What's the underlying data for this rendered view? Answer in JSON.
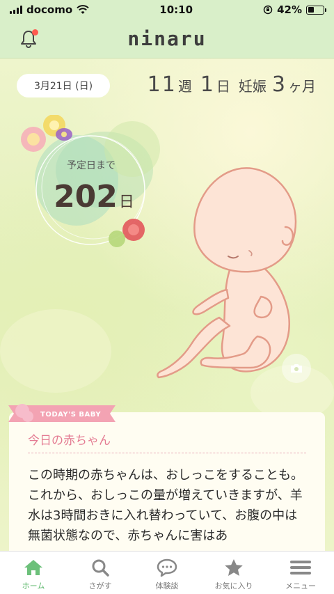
{
  "status_bar": {
    "carrier": "docomo",
    "time": "10:10",
    "battery_percent": "42%",
    "battery_level": 0.42
  },
  "header": {
    "logo": "ninaru",
    "notification_badge": true
  },
  "pregnancy": {
    "date": "3月21日 (日)",
    "weeks": "11",
    "weeks_unit": "週",
    "days": "1",
    "days_unit": "日",
    "month_label": "妊娠",
    "months": "3",
    "months_unit": "ヶ月",
    "due_label": "予定日まで",
    "due_days": "202",
    "due_days_unit": "日"
  },
  "today_card": {
    "ribbon": "TODAY'S BABY",
    "title": "今日の赤ちゃん",
    "body": "この時期の赤ちゃんは、おしっこをすることも。これから、おしっこの量が増えていきますが、羊水は3時間おきに入れ替わっていて、お腹の中は無菌状態なので、赤ちゃんに害はあ"
  },
  "nav": [
    {
      "label": "ホーム",
      "icon": "home-icon",
      "active": true
    },
    {
      "label": "さがす",
      "icon": "search-icon",
      "active": false
    },
    {
      "label": "体験談",
      "icon": "chat-icon",
      "active": false
    },
    {
      "label": "お気に入り",
      "icon": "star-icon",
      "active": false
    },
    {
      "label": "メニュー",
      "icon": "menu-icon",
      "active": false
    }
  ],
  "colors": {
    "accent_green": "#5db86c",
    "header_bg": "#d9efc9",
    "pink": "#e47c93"
  }
}
